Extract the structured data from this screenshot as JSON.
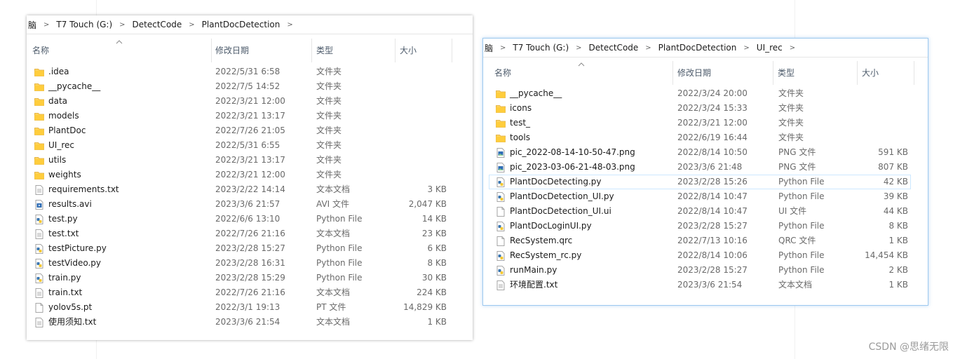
{
  "window_left": {
    "breadcrumbs": [
      "脑",
      "T7 Touch (G:)",
      "DetectCode",
      "PlantDocDetection"
    ],
    "columns": {
      "name": "名称",
      "date": "修改日期",
      "type": "类型",
      "size": "大小"
    },
    "files": [
      {
        "name": ".idea",
        "date": "2022/5/31 6:58",
        "type": "文件夹",
        "size": "",
        "icon": "folder-icon"
      },
      {
        "name": "__pycache__",
        "date": "2022/7/5 14:52",
        "type": "文件夹",
        "size": "",
        "icon": "folder-icon"
      },
      {
        "name": "data",
        "date": "2022/3/21 12:00",
        "type": "文件夹",
        "size": "",
        "icon": "folder-icon"
      },
      {
        "name": "models",
        "date": "2022/3/21 13:17",
        "type": "文件夹",
        "size": "",
        "icon": "folder-icon"
      },
      {
        "name": "PlantDoc",
        "date": "2022/7/26 21:05",
        "type": "文件夹",
        "size": "",
        "icon": "folder-icon"
      },
      {
        "name": "UI_rec",
        "date": "2022/5/31 6:55",
        "type": "文件夹",
        "size": "",
        "icon": "folder-icon"
      },
      {
        "name": "utils",
        "date": "2022/3/21 13:17",
        "type": "文件夹",
        "size": "",
        "icon": "folder-icon"
      },
      {
        "name": "weights",
        "date": "2022/3/21 12:00",
        "type": "文件夹",
        "size": "",
        "icon": "folder-icon"
      },
      {
        "name": "requirements.txt",
        "date": "2023/2/22 14:14",
        "type": "文本文档",
        "size": "3 KB",
        "icon": "text-file-icon"
      },
      {
        "name": "results.avi",
        "date": "2023/3/6 21:57",
        "type": "AVI 文件",
        "size": "2,047 KB",
        "icon": "video-file-icon"
      },
      {
        "name": "test.py",
        "date": "2022/6/6 13:10",
        "type": "Python File",
        "size": "14 KB",
        "icon": "python-file-icon"
      },
      {
        "name": "test.txt",
        "date": "2022/7/26 21:16",
        "type": "文本文档",
        "size": "23 KB",
        "icon": "text-file-icon"
      },
      {
        "name": "testPicture.py",
        "date": "2023/2/28 15:27",
        "type": "Python File",
        "size": "6 KB",
        "icon": "python-file-icon"
      },
      {
        "name": "testVideo.py",
        "date": "2023/2/28 16:31",
        "type": "Python File",
        "size": "8 KB",
        "icon": "python-file-icon"
      },
      {
        "name": "train.py",
        "date": "2023/2/28 15:29",
        "type": "Python File",
        "size": "30 KB",
        "icon": "python-file-icon"
      },
      {
        "name": "train.txt",
        "date": "2022/7/26 21:16",
        "type": "文本文档",
        "size": "224 KB",
        "icon": "text-file-icon"
      },
      {
        "name": "yolov5s.pt",
        "date": "2022/3/1 19:13",
        "type": "PT 文件",
        "size": "14,829 KB",
        "icon": "blank-file-icon"
      },
      {
        "name": "使用须知.txt",
        "date": "2023/3/6 21:54",
        "type": "文本文档",
        "size": "1 KB",
        "icon": "text-file-icon"
      }
    ]
  },
  "window_right": {
    "breadcrumbs": [
      "脑",
      "T7 Touch (G:)",
      "DetectCode",
      "PlantDocDetection",
      "UI_rec"
    ],
    "columns": {
      "name": "名称",
      "date": "修改日期",
      "type": "类型",
      "size": "大小"
    },
    "files": [
      {
        "name": "__pycache__",
        "date": "2022/3/24 20:00",
        "type": "文件夹",
        "size": "",
        "icon": "folder-icon"
      },
      {
        "name": "icons",
        "date": "2022/3/24 15:33",
        "type": "文件夹",
        "size": "",
        "icon": "folder-icon"
      },
      {
        "name": "test_",
        "date": "2022/3/21 12:00",
        "type": "文件夹",
        "size": "",
        "icon": "folder-icon"
      },
      {
        "name": "tools",
        "date": "2022/6/19 16:44",
        "type": "文件夹",
        "size": "",
        "icon": "folder-icon"
      },
      {
        "name": "pic_2022-08-14-10-50-47.png",
        "date": "2022/8/14 10:50",
        "type": "PNG 文件",
        "size": "591 KB",
        "icon": "image-file-icon"
      },
      {
        "name": "pic_2023-03-06-21-48-03.png",
        "date": "2023/3/6 21:48",
        "type": "PNG 文件",
        "size": "807 KB",
        "icon": "image-file-icon"
      },
      {
        "name": "PlantDocDetecting.py",
        "date": "2023/2/28 15:26",
        "type": "Python File",
        "size": "42 KB",
        "icon": "python-file-icon",
        "selected": true
      },
      {
        "name": "PlantDocDetection_UI.py",
        "date": "2022/8/14 10:47",
        "type": "Python File",
        "size": "39 KB",
        "icon": "python-file-icon"
      },
      {
        "name": "PlantDocDetection_UI.ui",
        "date": "2022/8/14 10:47",
        "type": "UI 文件",
        "size": "44 KB",
        "icon": "blank-file-icon"
      },
      {
        "name": "PlantDocLoginUI.py",
        "date": "2023/2/28 15:27",
        "type": "Python File",
        "size": "8 KB",
        "icon": "python-file-icon"
      },
      {
        "name": "RecSystem.qrc",
        "date": "2022/7/13 10:16",
        "type": "QRC 文件",
        "size": "1 KB",
        "icon": "blank-file-icon"
      },
      {
        "name": "RecSystem_rc.py",
        "date": "2022/8/14 10:06",
        "type": "Python File",
        "size": "14,454 KB",
        "icon": "python-file-icon"
      },
      {
        "name": "runMain.py",
        "date": "2023/2/28 15:27",
        "type": "Python File",
        "size": "2 KB",
        "icon": "python-file-icon"
      },
      {
        "name": "环境配置.txt",
        "date": "2023/3/6 21:54",
        "type": "文本文档",
        "size": "1 KB",
        "icon": "text-file-icon"
      }
    ]
  },
  "watermark": "CSDN @思绪无限"
}
